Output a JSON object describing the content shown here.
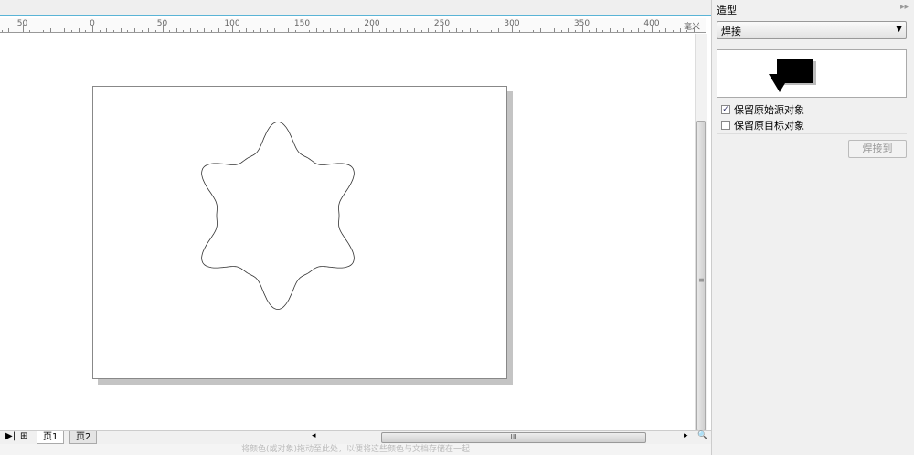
{
  "ruler": {
    "unit": "毫米",
    "labels": [
      "50",
      "0",
      "50",
      "100",
      "150",
      "200",
      "250",
      "300",
      "350",
      "400"
    ]
  },
  "pages": {
    "tabs": [
      "页1",
      "页2"
    ],
    "active": 0
  },
  "status": {
    "palette_hint": "将颜色(或对象)拖动至此处，以便将这些颜色与文档存储在一起"
  },
  "panel": {
    "title": "造型",
    "operation": "焊接",
    "options": [
      {
        "label": "保留原始源对象",
        "checked": true
      },
      {
        "label": "保留原目标对象",
        "checked": false
      }
    ],
    "apply_label": "焊接到"
  },
  "colors": {
    "accent": "#5ab4d6"
  }
}
